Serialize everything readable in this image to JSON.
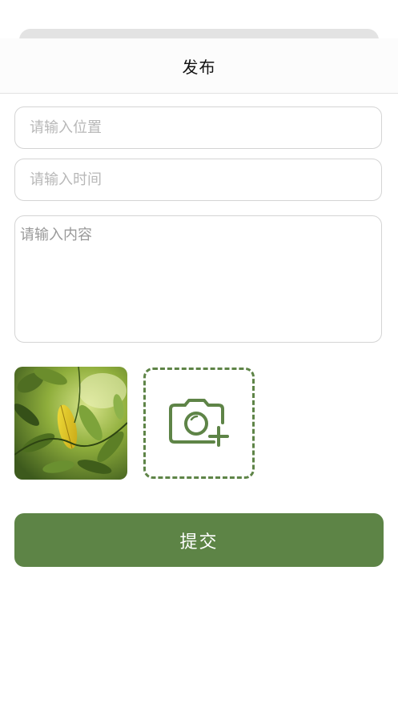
{
  "header": {
    "title": "发布"
  },
  "form": {
    "location_placeholder": "请输入位置",
    "time_placeholder": "请输入时间",
    "content_placeholder": "请输入内容"
  },
  "photos": {
    "uploaded_count": 1,
    "add_icon": "camera-plus-icon"
  },
  "actions": {
    "submit_label": "提交"
  },
  "colors": {
    "accent": "#5d8446",
    "dashed_border": "#5e8447",
    "border": "#d4d4d4",
    "placeholder": "#b8b8b8"
  }
}
